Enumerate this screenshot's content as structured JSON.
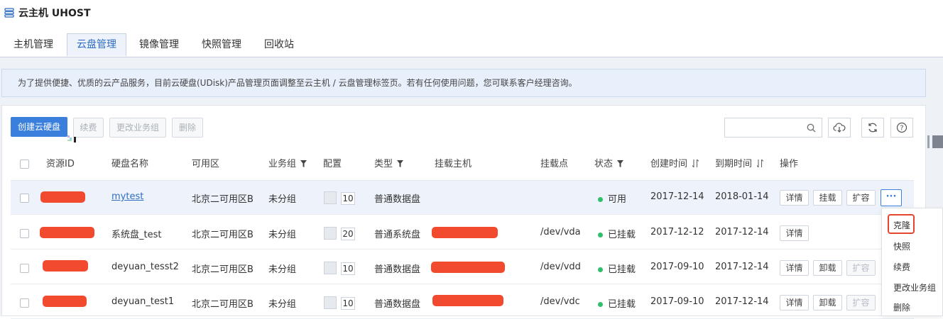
{
  "app": {
    "title": "云主机 UHOST"
  },
  "tabs": [
    {
      "label": "主机管理"
    },
    {
      "label": "云盘管理"
    },
    {
      "label": "镜像管理"
    },
    {
      "label": "快照管理"
    },
    {
      "label": "回收站"
    }
  ],
  "notice": "为了提供便捷、优质的云产品服务，目前云硬盘(UDisk)产品管理页面调整至云主机 / 云盘管理标签页。若有任何使用问题，您可联系客户经理咨询。",
  "toolbar": {
    "create": "创建云硬盘",
    "renew": "续费",
    "change_group": "更改业务组",
    "delete": "删除",
    "search_placeholder": ""
  },
  "table": {
    "headers": {
      "id": "资源ID",
      "name": "硬盘名称",
      "zone": "可用区",
      "group": "业务组",
      "config": "配置",
      "type": "类型",
      "host": "挂载主机",
      "mount": "挂载点",
      "status": "状态",
      "created": "创建时间",
      "expires": "到期时间",
      "actions": "操作"
    },
    "rows": [
      {
        "name": "mytest",
        "zone": "北京二可用区B",
        "group": "未分组",
        "size": "10",
        "type": "普通数据盘",
        "mount": "",
        "status": "可用",
        "created": "2017-12-14",
        "expires": "2018-01-14"
      },
      {
        "name": "系统盘_test",
        "zone": "北京二可用区B",
        "group": "未分组",
        "size": "20",
        "type": "普通系统盘",
        "mount": "/dev/vda",
        "status": "已挂载",
        "created": "2017-12-12",
        "expires": "2017-12-14"
      },
      {
        "name": "deyuan_tesst2",
        "zone": "北京二可用区B",
        "group": "未分组",
        "size": "10",
        "type": "普通数据盘",
        "mount": "/dev/vdd",
        "status": "已挂载",
        "created": "2017-09-10",
        "expires": "2017-12-14"
      },
      {
        "name": "deyuan_test1",
        "zone": "北京二可用区B",
        "group": "未分组",
        "size": "10",
        "type": "普通数据盘",
        "mount": "/dev/vdc",
        "status": "已挂载",
        "created": "2017-09-10",
        "expires": "2017-12-14"
      }
    ],
    "actions": {
      "details": "详情",
      "attach": "挂载",
      "detach": "卸载",
      "expand": "扩容",
      "more": "···"
    }
  },
  "more_menu": [
    {
      "label": "克隆"
    },
    {
      "label": "快照"
    },
    {
      "label": "续费"
    },
    {
      "label": "更改业务组"
    },
    {
      "label": "删除"
    }
  ],
  "colors": {
    "accent": "#3a7fdc",
    "status_ok": "#2dbf6a",
    "redaction": "#f24a2f",
    "highlight": "#e5452d"
  }
}
